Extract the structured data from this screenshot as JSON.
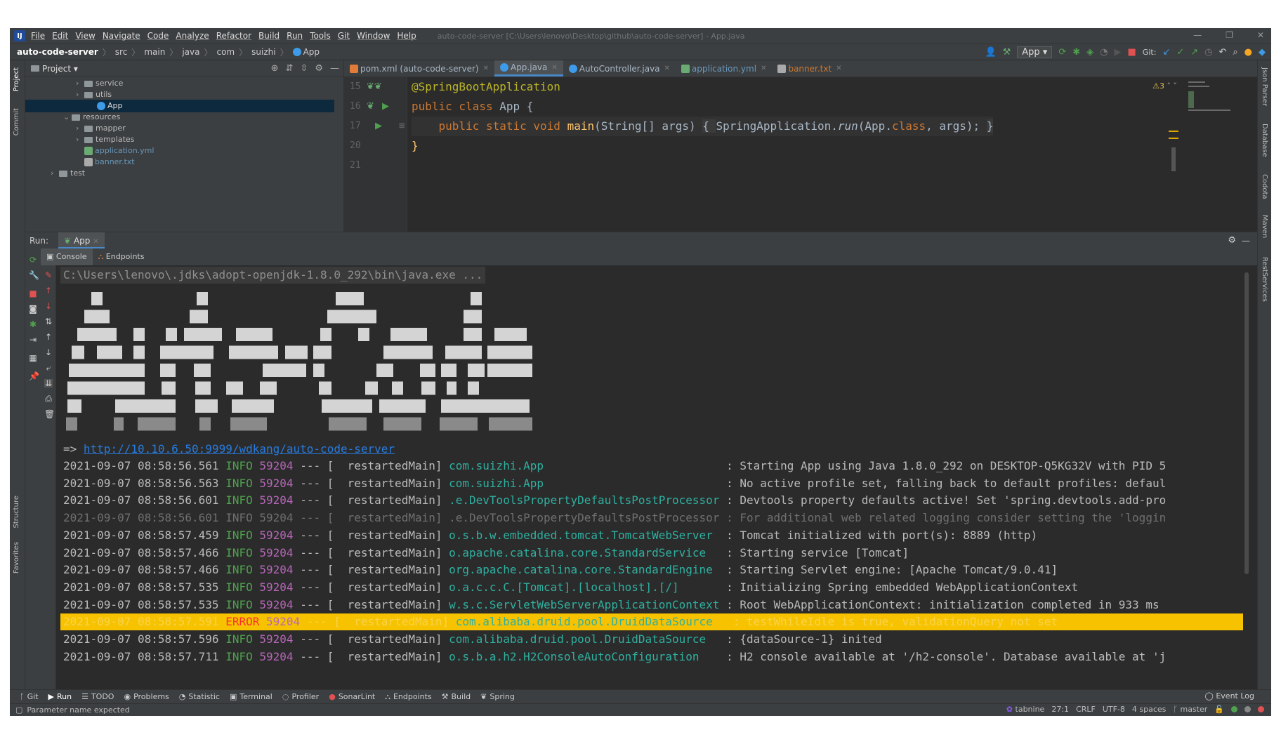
{
  "title_bar": {
    "menu": [
      "File",
      "Edit",
      "View",
      "Navigate",
      "Code",
      "Analyze",
      "Refactor",
      "Build",
      "Run",
      "Tools",
      "Git",
      "Window",
      "Help"
    ],
    "window_title": "auto-code-server [C:\\Users\\lenovo\\Desktop\\github\\auto-code-server] - App.java",
    "controls": [
      "—",
      "❐",
      "✕"
    ]
  },
  "breadcrumb": {
    "project": "auto-code-server",
    "parts": [
      "src",
      "main",
      "java",
      "com",
      "suizhi",
      "App"
    ]
  },
  "toolbar": {
    "run_config": "App ▾",
    "git_label": "Git:"
  },
  "side_tabs": {
    "left": [
      "Project",
      "Commit",
      "Structure",
      "Favorites"
    ],
    "right": [
      "Json Parser",
      "Database",
      "Codota",
      "Maven",
      "RestServices"
    ]
  },
  "project_panel": {
    "title": "Project ▾",
    "items": [
      {
        "label": "service",
        "type": "folder",
        "indent": 4,
        "expanded": false
      },
      {
        "label": "utils",
        "type": "folder",
        "indent": 4,
        "expanded": false
      },
      {
        "label": "App",
        "type": "class",
        "indent": 5,
        "selected": true
      },
      {
        "label": "resources",
        "type": "folder",
        "indent": 3,
        "expanded": true
      },
      {
        "label": "mapper",
        "type": "folder",
        "indent": 4,
        "expanded": false
      },
      {
        "label": "templates",
        "type": "folder",
        "indent": 4,
        "expanded": false
      },
      {
        "label": "application.yml",
        "type": "yml",
        "indent": 4
      },
      {
        "label": "banner.txt",
        "type": "txt",
        "indent": 4
      },
      {
        "label": "test",
        "type": "folder",
        "indent": 2,
        "expanded": false
      }
    ]
  },
  "editor": {
    "tabs": [
      {
        "label": "pom.xml (auto-code-server)",
        "active": false,
        "color": "#a9b7c6"
      },
      {
        "label": "App.java",
        "active": true,
        "color": "#a9b7c6"
      },
      {
        "label": "AutoController.java",
        "active": false,
        "color": "#a9b7c6"
      },
      {
        "label": "application.yml",
        "active": false,
        "color": "#6897bb"
      },
      {
        "label": "banner.txt",
        "active": false,
        "color": "#cc7832"
      }
    ],
    "line_numbers": [
      "15",
      "16",
      "17",
      "20",
      "21"
    ],
    "warnings": "⚠3",
    "code": {
      "annotation": "@SpringBootApplication",
      "class_decl_kw": "public class ",
      "class_name": "App {",
      "main_kw": "public static void ",
      "main_name": "main",
      "main_args": "(String[] args) ",
      "body_open": "{ ",
      "body_call": "SpringApplication.",
      "body_run": "run",
      "body_args_1": "(App.",
      "body_class_kw": "class",
      "body_args_2": ", args); ",
      "body_close": "}",
      "closing": "}"
    }
  },
  "run_panel": {
    "label": "Run:",
    "tab": "App",
    "subtabs": [
      "Console",
      "Endpoints"
    ]
  },
  "console": {
    "command": "C:\\Users\\lenovo\\.jdks\\adopt-openjdk-1.8.0_292\\bin\\java.exe ...",
    "url_prefix": "=> ",
    "url": "http://10.10.6.50:9999/wdkang/auto-code-server",
    "logs": [
      {
        "ts": "2021-09-07 08:58:56.561",
        "level": "INFO",
        "pid": "59204",
        "sep": "--- [",
        "thread": "  restartedMain]",
        "logger": "com.suizhi.App                           ",
        "msg": ": Starting App using Java 1.8.0_292 on DESKTOP-Q5KG32V with PID 5",
        "style": "normal"
      },
      {
        "ts": "2021-09-07 08:58:56.563",
        "level": "INFO",
        "pid": "59204",
        "sep": "--- [",
        "thread": "  restartedMain]",
        "logger": "com.suizhi.App                           ",
        "msg": ": No active profile set, falling back to default profiles: defaul",
        "style": "normal"
      },
      {
        "ts": "2021-09-07 08:58:56.601",
        "level": "INFO",
        "pid": "59204",
        "sep": "--- [",
        "thread": "  restartedMain]",
        "logger": ".e.DevToolsPropertyDefaultsPostProcessor ",
        "msg": ": Devtools property defaults active! Set 'spring.devtools.add-pro",
        "style": "normal"
      },
      {
        "ts": "2021-09-07 08:58:56.601",
        "level": "INFO",
        "pid": "59204",
        "sep": "--- [",
        "thread": "  restartedMain]",
        "logger": ".e.DevToolsPropertyDefaultsPostProcessor ",
        "msg": ": For additional web related logging consider setting the 'loggin",
        "style": "dim"
      },
      {
        "ts": "2021-09-07 08:58:57.459",
        "level": "INFO",
        "pid": "59204",
        "sep": "--- [",
        "thread": "  restartedMain]",
        "logger": "o.s.b.w.embedded.tomcat.TomcatWebServer  ",
        "msg": ": Tomcat initialized with port(s): 8889 (http)",
        "style": "normal"
      },
      {
        "ts": "2021-09-07 08:58:57.466",
        "level": "INFO",
        "pid": "59204",
        "sep": "--- [",
        "thread": "  restartedMain]",
        "logger": "o.apache.catalina.core.StandardService   ",
        "msg": ": Starting service [Tomcat]",
        "style": "normal"
      },
      {
        "ts": "2021-09-07 08:58:57.466",
        "level": "INFO",
        "pid": "59204",
        "sep": "--- [",
        "thread": "  restartedMain]",
        "logger": "org.apache.catalina.core.StandardEngine  ",
        "msg": ": Starting Servlet engine: [Apache Tomcat/9.0.41]",
        "style": "normal"
      },
      {
        "ts": "2021-09-07 08:58:57.535",
        "level": "INFO",
        "pid": "59204",
        "sep": "--- [",
        "thread": "  restartedMain]",
        "logger": "o.a.c.c.C.[Tomcat].[localhost].[/]       ",
        "msg": ": Initializing Spring embedded WebApplicationContext",
        "style": "normal"
      },
      {
        "ts": "2021-09-07 08:58:57.535",
        "level": "INFO",
        "pid": "59204",
        "sep": "--- [",
        "thread": "  restartedMain]",
        "logger": "w.s.c.ServletWebServerApplicationContext ",
        "msg": ": Root WebApplicationContext: initialization completed in 933 ms",
        "style": "normal"
      },
      {
        "ts": "2021-09-07 08:58:57.591",
        "level": "ERROR",
        "pid": "59204",
        "sep": "--- [",
        "thread": "  restartedMain]",
        "logger": "com.alibaba.druid.pool.DruidDataSource   ",
        "msg": ": testWhileIdle is true, validationQuery not set",
        "style": "error"
      },
      {
        "ts": "2021-09-07 08:58:57.596",
        "level": "INFO",
        "pid": "59204",
        "sep": "--- [",
        "thread": "  restartedMain]",
        "logger": "com.alibaba.druid.pool.DruidDataSource   ",
        "msg": ": {dataSource-1} inited",
        "style": "normal"
      },
      {
        "ts": "2021-09-07 08:58:57.711",
        "level": "INFO",
        "pid": "59204",
        "sep": "--- [",
        "thread": "  restartedMain]",
        "logger": "o.s.b.a.h2.H2ConsoleAutoConfiguration    ",
        "msg": ": H2 console available at '/h2-console'. Database available at 'j",
        "style": "normal"
      }
    ]
  },
  "bottom_tabs": [
    "Git",
    "Run",
    "TODO",
    "Problems",
    "Statistic",
    "Terminal",
    "Profiler",
    "SonarLint",
    "Endpoints",
    "Build",
    "Spring"
  ],
  "event_log": "Event Log",
  "status": {
    "message": "Parameter name expected",
    "tabnine": "tabnine",
    "position": "27:1",
    "line_sep": "CRLF",
    "encoding": "UTF-8",
    "indent": "4 spaces",
    "branch": "master"
  },
  "colors": {
    "bg": "#2b2b2b",
    "panel": "#3c3f41",
    "accent": "#4a88c7",
    "info": "#4fa04f",
    "pid": "#b667b8",
    "logger": "#2fb0a0",
    "error_bg": "#f7c300",
    "error": "#ff2e2e",
    "link": "#287bde"
  }
}
